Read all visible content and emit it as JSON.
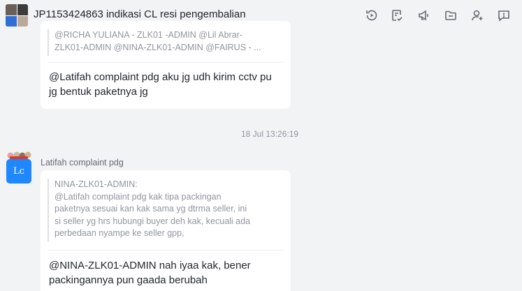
{
  "header": {
    "title": "JP1153424863 indikasi CL resi pengembalian",
    "icons": [
      "history-icon",
      "task-icon",
      "announcement-icon",
      "folder-icon",
      "add-member-icon",
      "chat-settings-icon"
    ]
  },
  "messages": [
    {
      "quote_lines": [
        "@RICHA YULIANA - ZLK01 -ADMIN @Lil Abrar-",
        "ZLK01-ADMIN @NINA-ZLK01-ADMIN @FAIRUS - ..."
      ],
      "text_lines": [
        "@Latifah complaint pdg aku jg udh kirim cctv pu",
        "jg bentuk paketnya jg"
      ]
    },
    {
      "timestamp": "18 Jul 13:26:19",
      "sender": "Latifah complaint pdg",
      "avatar_text": "Lc",
      "quote_lines": [
        "NINA-ZLK01-ADMIN:",
        "@Latifah complaint pdg kak tipa packingan",
        "paketnya sesuai kan kak sama yg dtrma seller, ini",
        "si seller yg hrs hubungi buyer deh kak, kecuali ada",
        "perbedaan nyampe ke seller gpp,"
      ],
      "text_lines": [
        "@NINA-ZLK01-ADMIN nah iyaa kak, bener",
        "packingannya pun gaada berubah"
      ]
    }
  ],
  "colors": {
    "background": "#f2f3f5",
    "bubble": "#ffffff",
    "avatar": "#1f87ff",
    "muted_text": "#8f959e"
  }
}
